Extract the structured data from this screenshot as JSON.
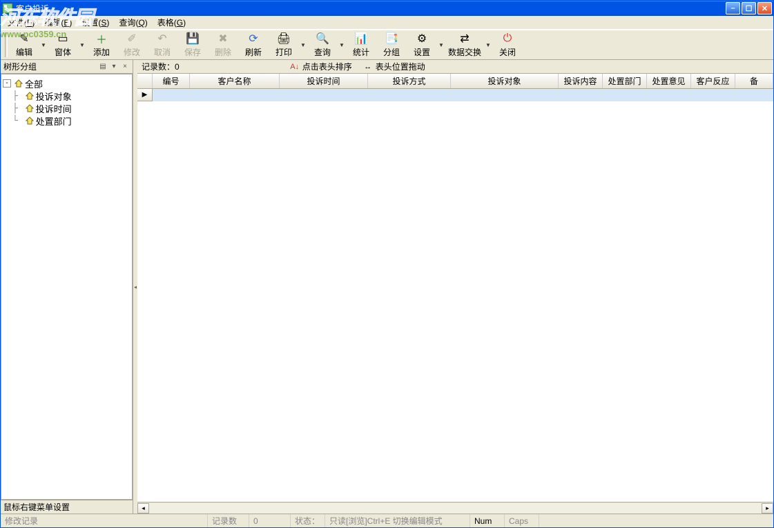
{
  "window": {
    "title": "客户投诉"
  },
  "watermark": {
    "logo": "河东软件园",
    "url": "www.pc0359.cn"
  },
  "menu": {
    "file": {
      "label": "文件",
      "accel": "F"
    },
    "edit": {
      "label": "编辑",
      "accel": "E"
    },
    "setting": {
      "label": "设置",
      "accel": "S"
    },
    "query": {
      "label": "查询",
      "accel": "Q"
    },
    "grid": {
      "label": "表格",
      "accel": "G"
    }
  },
  "toolbar": {
    "edit": "编辑",
    "window": "窗体",
    "add": "添加",
    "modify": "修改",
    "cancel": "取消",
    "save": "保存",
    "delete": "删除",
    "refresh": "刷新",
    "print": "打印",
    "query": "查询",
    "stats": "统计",
    "group": "分组",
    "config": "设置",
    "exchange": "数据交换",
    "close": "关闭"
  },
  "sidebar": {
    "title": "树形分组",
    "foot": "鼠标右键菜单设置",
    "nodes": {
      "all": "全部",
      "c1": "投诉对象",
      "c2": "投诉时间",
      "c3": "处置部门"
    }
  },
  "infobar": {
    "records_label": "记录数：",
    "records_value": "0",
    "hint_sort": "点击表头排序",
    "hint_drag": "表头位置拖动"
  },
  "columns": {
    "c0": "编号",
    "c1": "客户名称",
    "c2": "投诉时间",
    "c3": "投诉方式",
    "c4": "投诉对象",
    "c5": "投诉内容",
    "c6": "处置部门",
    "c7": "处置意见",
    "c8": "客户反应",
    "c9": "备"
  },
  "status": {
    "s0": "修改记录",
    "s1_label": "记录数",
    "s1_value": "0",
    "s2_label": "状态：",
    "s2_value": "只读[浏览]Ctrl+E 切换编辑模式",
    "s3": "Num",
    "s4": "Caps"
  }
}
